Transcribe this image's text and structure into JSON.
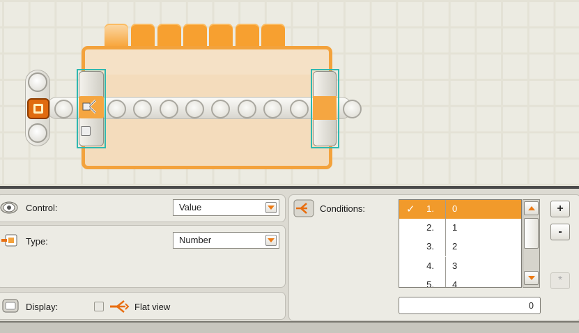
{
  "canvas": {
    "switch_block": {
      "tab_count": 7,
      "accent": "#f7a030",
      "frame_color": "#2fb8b0"
    }
  },
  "panel": {
    "control": {
      "label": "Control:",
      "value": "Value",
      "icon": "eye-icon"
    },
    "type": {
      "label": "Type:",
      "value": "Number",
      "icon": "type-plug-icon"
    },
    "display": {
      "label": "Display:",
      "icon": "display-icon",
      "flat_view_label": "Flat view",
      "flat_view_checked": false
    },
    "conditions": {
      "label": "Conditions:",
      "icon": "conditions-icon",
      "rows": [
        {
          "num": "1.",
          "value": "0",
          "selected": true,
          "check": "✓"
        },
        {
          "num": "2.",
          "value": "1",
          "selected": false,
          "check": ""
        },
        {
          "num": "3.",
          "value": "2",
          "selected": false,
          "check": ""
        },
        {
          "num": "4.",
          "value": "3",
          "selected": false,
          "check": ""
        },
        {
          "num": "5.",
          "value": "4",
          "selected": false,
          "check": ""
        }
      ],
      "input_value": "0",
      "add_label": "+",
      "remove_label": "-",
      "default_label": "*"
    }
  }
}
